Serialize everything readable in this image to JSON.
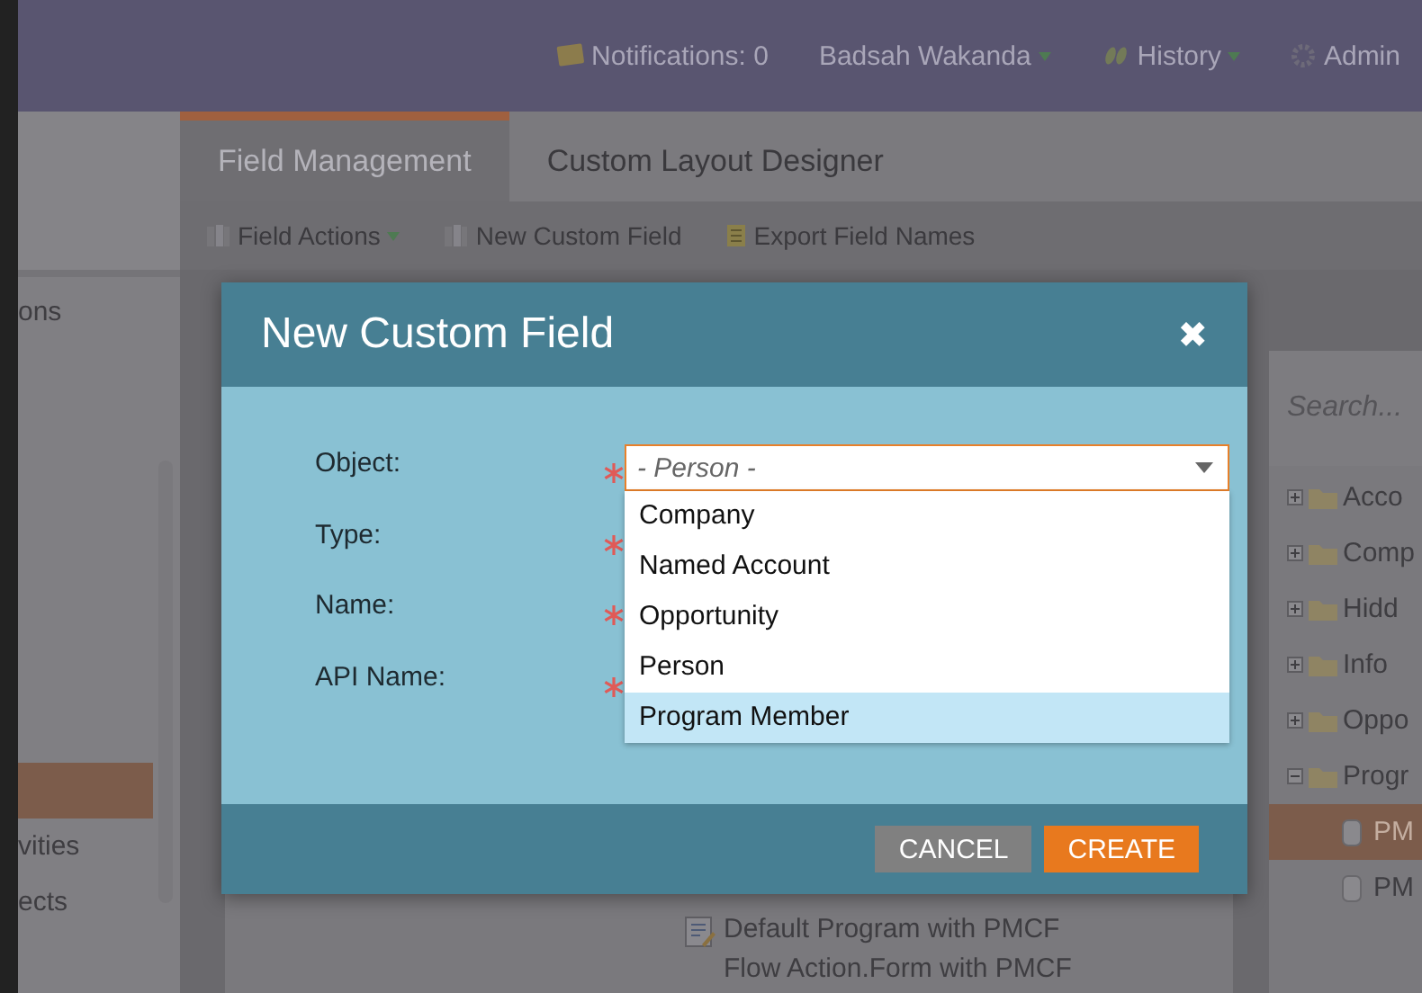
{
  "top_bar": {
    "notifications": "Notifications: 0",
    "user": "Badsah Wakanda",
    "history": "History",
    "admin": "Admin"
  },
  "tabs": [
    {
      "label": "Field Management",
      "selected": true
    },
    {
      "label": "Custom Layout Designer",
      "selected": false
    }
  ],
  "toolbar": [
    {
      "kind": "fields",
      "label": "Field Actions",
      "dropdown": true
    },
    {
      "kind": "fields",
      "label": "New Custom Field",
      "dropdown": false
    },
    {
      "kind": "export",
      "label": "Export Field Names",
      "dropdown": false
    }
  ],
  "left_nav": [
    {
      "label": "ons",
      "selected": false
    },
    {
      "selected": true
    },
    {
      "label": "vities",
      "selected": false
    },
    {
      "label": "ects",
      "selected": false
    }
  ],
  "program_list": [
    {
      "label": "Default Program with PMCF Flow Action.Form with PMCF"
    }
  ],
  "field_tree": {
    "search_placeholder": "Search...",
    "items": [
      {
        "label": "Acco",
        "expanded": false
      },
      {
        "label": "Comp",
        "expanded": false
      },
      {
        "label": "Hidd",
        "expanded": false
      },
      {
        "label": "Info",
        "expanded": false
      },
      {
        "label": "Oppo",
        "expanded": false
      },
      {
        "label": "Progr",
        "expanded": true,
        "children": [
          {
            "label": "PM",
            "selected": true
          },
          {
            "label": "PM",
            "selected": false
          }
        ]
      }
    ]
  },
  "dialog": {
    "title": "New Custom Field",
    "close": "✖",
    "fields": [
      {
        "label": "Object:",
        "required": true
      },
      {
        "label": "Type:",
        "required": true
      },
      {
        "label": "Name:",
        "required": true
      },
      {
        "label": "API Name:",
        "required": true
      }
    ],
    "object_select": {
      "value": "- Person -",
      "options": [
        {
          "label": "Company",
          "selected": false
        },
        {
          "label": "Named Account",
          "selected": false
        },
        {
          "label": "Opportunity",
          "selected": false
        },
        {
          "label": "Person",
          "selected": false
        },
        {
          "label": "Program Member",
          "selected": true
        }
      ]
    },
    "buttons": [
      {
        "kind": "secondary",
        "label": "CANCEL"
      },
      {
        "kind": "primary",
        "label": "CREATE"
      }
    ]
  }
}
